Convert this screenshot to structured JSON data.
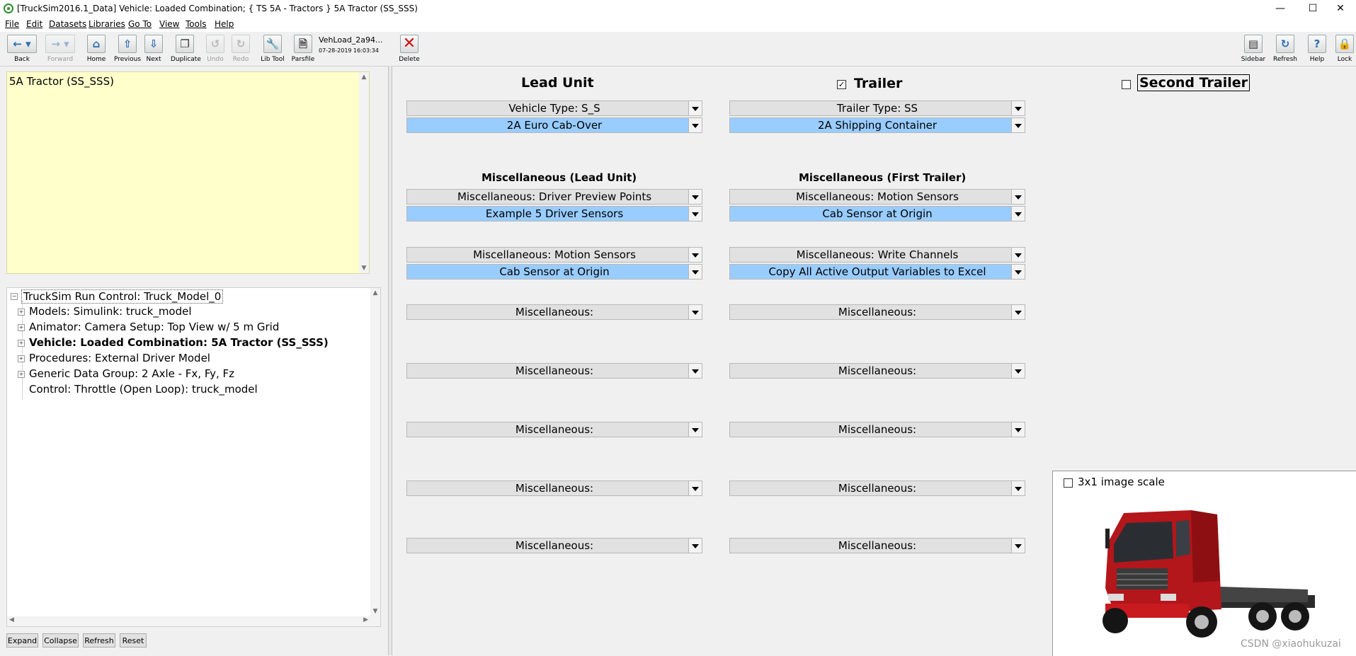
{
  "window": {
    "title": "[TruckSim2016.1_Data] Vehicle: Loaded Combination; { TS 5A - Tractors } 5A Tractor (SS_SSS)",
    "controls": [
      "—",
      "☐",
      "✕"
    ]
  },
  "menu": [
    "File",
    "Edit",
    "Datasets",
    "Libraries",
    "Go To",
    "View",
    "Tools",
    "Help"
  ],
  "toolbar": {
    "back": "Back",
    "forward": "Forward",
    "home": "Home",
    "previous": "Previous",
    "next": "Next",
    "duplicate": "Duplicate",
    "undo": "Undo",
    "redo": "Redo",
    "lib_tool": "Lib Tool",
    "parsfile": "Parsfile",
    "parsfile_name": "VehLoad_2a94...",
    "parsfile_date": "07-28-2019 16:03:34",
    "delete": "Delete",
    "sidebar": "Sidebar",
    "refresh": "Refresh",
    "help": "Help",
    "lock": "Lock"
  },
  "notes": {
    "text": "5A Tractor (SS_SSS)"
  },
  "tree": {
    "root": "TruckSim Run Control: Truck_Model_0",
    "items": [
      {
        "label": "Models: Simulink: truck_model",
        "bold": false
      },
      {
        "label": "Animator: Camera Setup: Top View w/ 5 m Grid",
        "bold": false
      },
      {
        "label": "Vehicle: Loaded Combination: 5A Tractor (SS_SSS)",
        "bold": true
      },
      {
        "label": "Procedures: External Driver Model",
        "bold": false
      },
      {
        "label": "Generic Data Group: 2 Axle - Fx, Fy, Fz",
        "bold": false
      },
      {
        "label": "Control: Throttle (Open Loop): truck_model",
        "bold": false
      }
    ],
    "buttons": [
      "Expand",
      "Collapse",
      "Refresh",
      "Reset"
    ]
  },
  "main": {
    "lead_unit": "Lead Unit",
    "trailer": "Trailer",
    "second_trailer": "Second Trailer",
    "lead": {
      "type_label": "Vehicle Type: S_S",
      "type_value": "2A Euro Cab-Over",
      "misc_title": "Miscellaneous (Lead Unit)",
      "misc1_label": "Miscellaneous: Driver Preview Points",
      "misc1_value": "Example 5 Driver Sensors",
      "misc2_label": "Miscellaneous: Motion Sensors",
      "misc2_value": "Cab Sensor at Origin",
      "empty": [
        "Miscellaneous:",
        "Miscellaneous:",
        "Miscellaneous:",
        "Miscellaneous:",
        "Miscellaneous:"
      ]
    },
    "trailer1": {
      "type_label": "Trailer Type: SS",
      "type_value": "2A Shipping Container",
      "misc_title": "Miscellaneous (First Trailer)",
      "misc1_label": "Miscellaneous: Motion Sensors",
      "misc1_value": "Cab Sensor at Origin",
      "misc2_label": "Miscellaneous: Write Channels",
      "misc2_value": "Copy All Active Output Variables to Excel",
      "empty": [
        "Miscellaneous:",
        "Miscellaneous:",
        "Miscellaneous:",
        "Miscellaneous:",
        "Miscellaneous:"
      ]
    },
    "image_scale_label": "3x1 image scale",
    "watermark": "CSDN @xiaohukuzai"
  },
  "colors": {
    "notes_bg": "#ffffcc",
    "selected_dropdown": "#99ccff",
    "truck_red": "#b3161b"
  },
  "state": {
    "trailer_checked": true,
    "second_trailer_checked": false,
    "image_scale_checked": false
  }
}
